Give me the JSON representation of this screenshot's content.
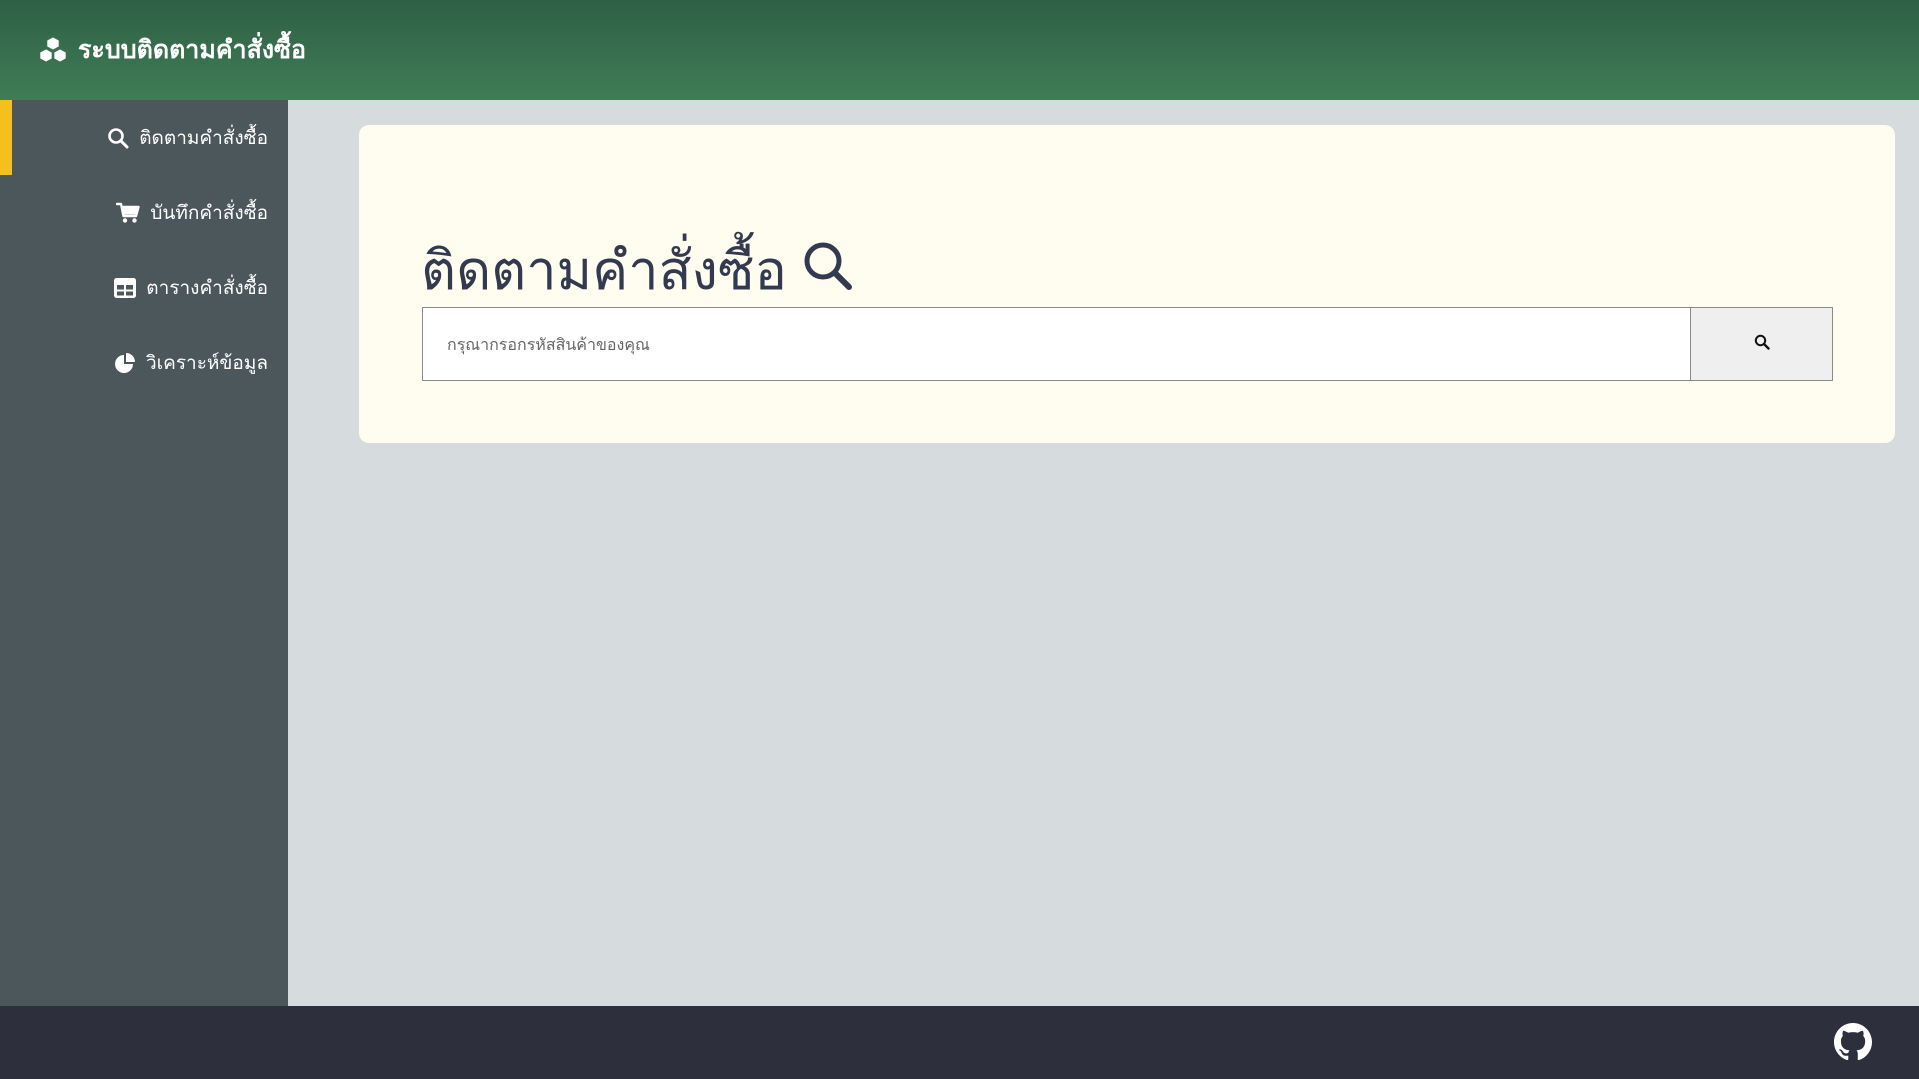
{
  "header": {
    "brand_icon": "cubes-icon",
    "title": "ระบบติดตามคำสั่งซื้อ"
  },
  "sidebar": {
    "items": [
      {
        "label": "ติดตามคำสั่งซื้อ",
        "icon": "search-icon",
        "active": true
      },
      {
        "label": "บันทึกคำสั่งซื้อ",
        "icon": "cart-icon",
        "active": false
      },
      {
        "label": "ตารางคำสั่งซื้อ",
        "icon": "table-icon",
        "active": false
      },
      {
        "label": "วิเคราะห์ข้อมูล",
        "icon": "pie-chart-icon",
        "active": false
      }
    ]
  },
  "main": {
    "title": "ติดตามคำสั่งซื้อ",
    "title_icon": "search-icon",
    "search": {
      "placeholder": "กรุณากรอกรหัสสินค้าของคุณ",
      "value": "",
      "button_icon": "search-icon"
    }
  },
  "footer": {
    "icon": "github-icon"
  },
  "colors": {
    "header_top": "#2f5f45",
    "header_bottom": "#3f7d56",
    "sidebar_bg": "#4c575b",
    "active_indicator": "#f4c01e",
    "main_bg": "#d6dbdd",
    "card_bg": "#fffdf0",
    "title_text": "#333a4f",
    "footer_bg": "#2d2f3d"
  }
}
